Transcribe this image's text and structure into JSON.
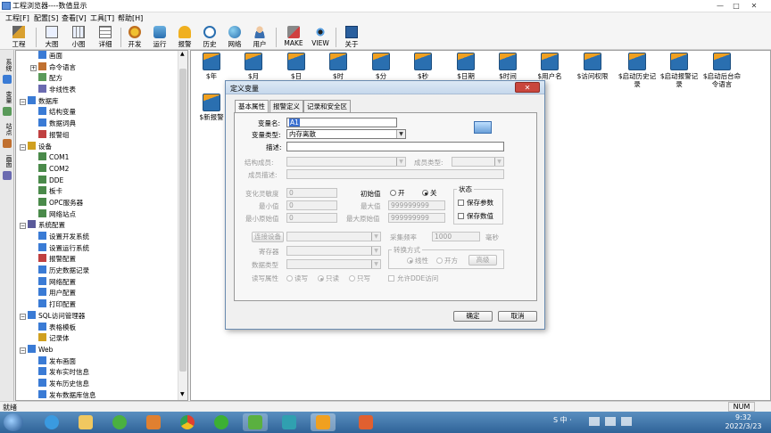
{
  "window": {
    "title": "工程浏览器----数值显示",
    "min": "—",
    "max": "□",
    "close": "✕"
  },
  "menu": [
    "工程[F]",
    "配置[S]",
    "查看[V]",
    "工具[T]",
    "帮助[H]"
  ],
  "toolbar": [
    "工程",
    "大图",
    "小图",
    "详细",
    "开发",
    "运行",
    "报警",
    "历史",
    "网络",
    "用户",
    "MAKE",
    "VIEW",
    "关于"
  ],
  "vtabs": [
    "系统",
    "变量",
    "站点",
    "画面"
  ],
  "tree": [
    {
      "label": "画面",
      "level": 2,
      "expander": "",
      "icon": "#3a7bd5"
    },
    {
      "label": "命令语言",
      "level": 2,
      "expander": "+",
      "icon": "#c07030"
    },
    {
      "label": "配方",
      "level": 2,
      "expander": "",
      "icon": "#5a9a5a"
    },
    {
      "label": "非线性表",
      "level": 2,
      "expander": "",
      "icon": "#6a6ab0"
    },
    {
      "label": "数据库",
      "level": 1,
      "expander": "−",
      "icon": "#3a7bd5"
    },
    {
      "label": "结构变量",
      "level": 2,
      "expander": "",
      "icon": "#3a7bd5"
    },
    {
      "label": "数据词典",
      "level": 2,
      "expander": "",
      "icon": "#3a7bd5"
    },
    {
      "label": "报警组",
      "level": 2,
      "expander": "",
      "icon": "#c04040"
    },
    {
      "label": "设备",
      "level": 1,
      "expander": "−",
      "icon": "#d0a020"
    },
    {
      "label": "COM1",
      "level": 2,
      "expander": "",
      "icon": "#4a8a4a"
    },
    {
      "label": "COM2",
      "level": 2,
      "expander": "",
      "icon": "#4a8a4a"
    },
    {
      "label": "DDE",
      "level": 2,
      "expander": "",
      "icon": "#4a8a4a"
    },
    {
      "label": "板卡",
      "level": 2,
      "expander": "",
      "icon": "#4a8a4a"
    },
    {
      "label": "OPC服务器",
      "level": 2,
      "expander": "",
      "icon": "#4a8a4a"
    },
    {
      "label": "网络站点",
      "level": 2,
      "expander": "",
      "icon": "#4a8a4a"
    },
    {
      "label": "系统配置",
      "level": 1,
      "expander": "−",
      "icon": "#5a5a9a"
    },
    {
      "label": "设置开发系统",
      "level": 2,
      "expander": "",
      "icon": "#3a7bd5"
    },
    {
      "label": "设置运行系统",
      "level": 2,
      "expander": "",
      "icon": "#3a7bd5"
    },
    {
      "label": "报警配置",
      "level": 2,
      "expander": "",
      "icon": "#c04040"
    },
    {
      "label": "历史数据记录",
      "level": 2,
      "expander": "",
      "icon": "#3a7bd5"
    },
    {
      "label": "网络配置",
      "level": 2,
      "expander": "",
      "icon": "#3a7bd5"
    },
    {
      "label": "用户配置",
      "level": 2,
      "expander": "",
      "icon": "#3a7bd5"
    },
    {
      "label": "打印配置",
      "level": 2,
      "expander": "",
      "icon": "#3a7bd5"
    },
    {
      "label": "SQL访问管理器",
      "level": 1,
      "expander": "−",
      "icon": "#3a7bd5"
    },
    {
      "label": "表格模板",
      "level": 2,
      "expander": "",
      "icon": "#3a7bd5"
    },
    {
      "label": "记录体",
      "level": 2,
      "expander": "",
      "icon": "#d0a020"
    },
    {
      "label": "Web",
      "level": 1,
      "expander": "−",
      "icon": "#3a7bd5"
    },
    {
      "label": "发布画面",
      "level": 2,
      "expander": "",
      "icon": "#3a7bd5"
    },
    {
      "label": "发布实时信息",
      "level": 2,
      "expander": "",
      "icon": "#3a7bd5"
    },
    {
      "label": "发布历史信息",
      "level": 2,
      "expander": "",
      "icon": "#3a7bd5"
    },
    {
      "label": "发布数据库信息",
      "level": 2,
      "expander": "",
      "icon": "#3a7bd5"
    }
  ],
  "variables": [
    "$年",
    "$月",
    "$日",
    "$时",
    "$分",
    "$秒",
    "$日期",
    "$时间",
    "$用户名",
    "$访问权限",
    "$启动历史记录",
    "$启动报警记录",
    "$启动后台命令语言",
    "$新报警"
  ],
  "dialog": {
    "title": "定义变量",
    "close": "✕",
    "tabs": [
      "基本属性",
      "报警定义",
      "记录和安全区"
    ],
    "fields": {
      "var_name_label": "变量名:",
      "var_name_value": "A1",
      "var_type_label": "变量类型:",
      "var_type_value": "内存离散",
      "desc_label": "描述:",
      "desc_value": "",
      "struct_member_label": "结构成员:",
      "struct_member_value": "",
      "member_type_label": "成员类型:",
      "member_type_value": "",
      "member_desc_label": "成员描述:",
      "member_desc_value": "",
      "sensitivity_label": "变化灵敏度",
      "sensitivity_value": "0",
      "init_label": "初始值",
      "init_on": "开",
      "init_off": "关",
      "min_label": "最小值",
      "min_value": "0",
      "max_label": "最大值",
      "max_value": "999999999",
      "min_raw_label": "最小原始值",
      "min_raw_value": "0",
      "max_raw_label": "最大原始值",
      "max_raw_value": "999999999",
      "status_label": "状态",
      "save_param": "保存参数",
      "save_value": "保存数值",
      "conn_device_btn": "连接设备",
      "conn_device_value": "",
      "collect_freq_label": "采集频率",
      "collect_freq_value": "1000",
      "collect_freq_unit": "毫秒",
      "register_label": "寄存器",
      "register_value": "",
      "convert_label": "转换方式",
      "linear": "线性",
      "sqrt": "开方",
      "advanced_btn": "高级",
      "data_type_label": "数据类型",
      "data_type_value": "",
      "rw_label": "读写属性",
      "rw_readwrite": "读写",
      "rw_readonly": "只读",
      "rw_writeonly": "只写",
      "allow_dde": "允许DDE访问"
    },
    "ok": "确定",
    "cancel": "取消"
  },
  "statusbar": {
    "left": "就绪",
    "right": "NUM"
  },
  "taskbar": {
    "time": "9:32",
    "date": "2022/3/23",
    "ime": "中",
    "tray_text": "S 中 ·"
  },
  "colors": {
    "accent": "#2f6398",
    "cube_body": "#2a6fb0",
    "cube_top": "#f0a020"
  }
}
